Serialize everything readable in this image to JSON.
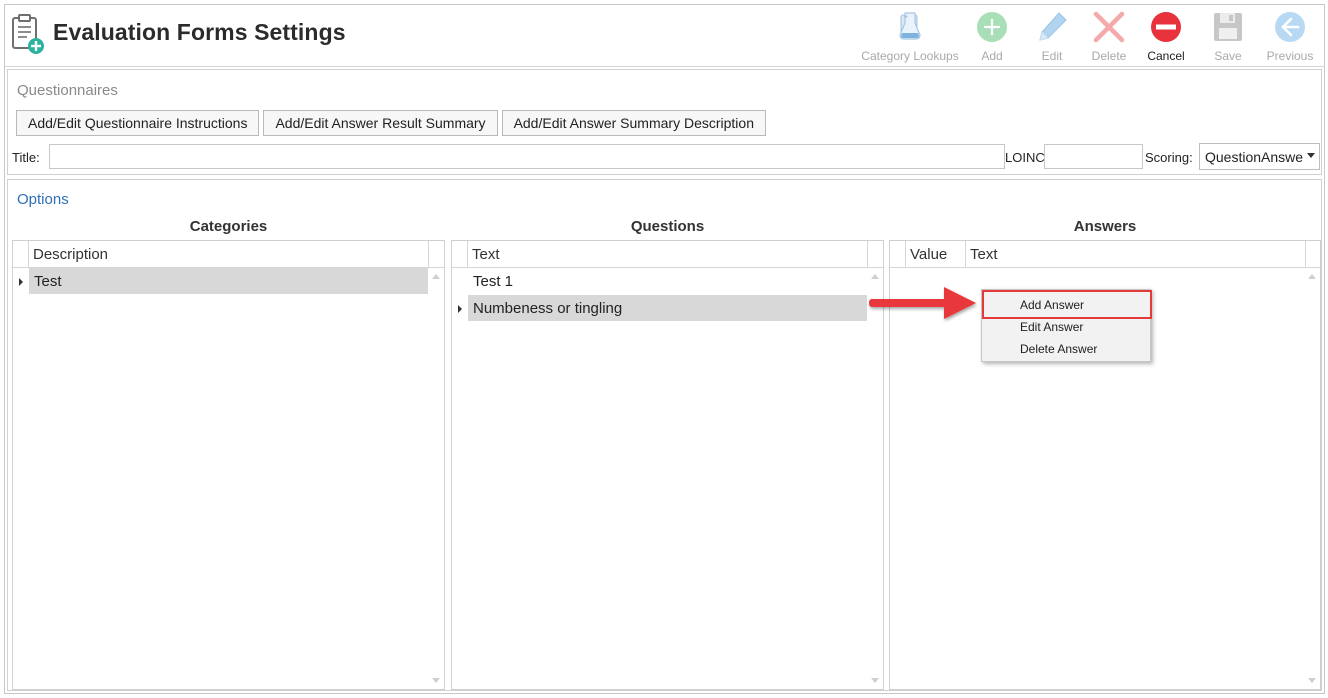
{
  "header": {
    "title": "Evaluation Forms Settings"
  },
  "toolbar": {
    "category_lookups": "Category Lookups",
    "add": "Add",
    "edit": "Edit",
    "delete": "Delete",
    "cancel": "Cancel",
    "save": "Save",
    "previous": "Previous"
  },
  "questionnaires": {
    "section_title": "Questionnaires",
    "buttons": [
      "Add/Edit Questionnaire Instructions",
      "Add/Edit Answer Result Summary",
      "Add/Edit Answer Summary Description"
    ],
    "title_label": "Title:",
    "title_value": "",
    "loinc_label": "LOINC",
    "loinc_value": "",
    "scoring_label": "Scoring:",
    "scoring_value": "QuestionAnswe"
  },
  "options": {
    "section_title": "Options",
    "categories": {
      "title": "Categories",
      "column": "Description",
      "rows": [
        "Test"
      ]
    },
    "questions": {
      "title": "Questions",
      "column": "Text",
      "rows": [
        "Test 1",
        "Numbeness or tingling"
      ]
    },
    "answers": {
      "title": "Answers",
      "columns": [
        "Value",
        "Text"
      ]
    }
  },
  "context_menu": {
    "items": [
      "Add Answer",
      "Edit Answer",
      "Delete Answer"
    ],
    "highlighted": "Add Answer"
  },
  "colors": {
    "accent_blue": "#2e6fb7",
    "highlight_red": "#e53a3a",
    "selected_row": "#d8d8d8",
    "cancel_red": "#e8333d",
    "add_green": "#a8dfb6"
  }
}
